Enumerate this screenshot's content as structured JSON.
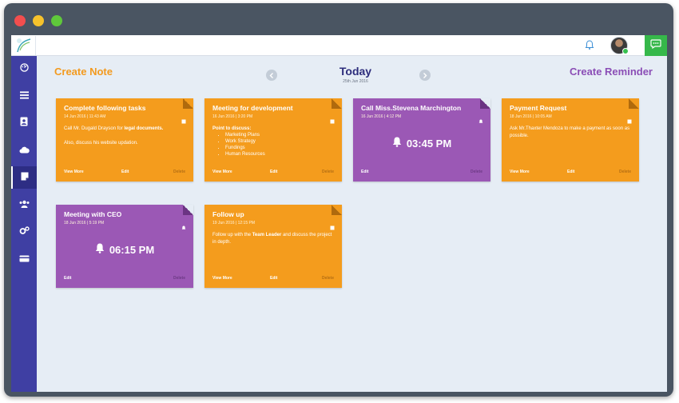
{
  "window": {
    "traffic_lights": [
      "close",
      "minimize",
      "maximize"
    ]
  },
  "topbar": {
    "icons": [
      "logo-icon",
      "bell-icon",
      "avatar",
      "chat-icon"
    ],
    "accent": "#36b84a"
  },
  "sidebar": {
    "color": "#3f3fa3",
    "items": [
      {
        "icon": "dashboard-icon"
      },
      {
        "icon": "list-icon"
      },
      {
        "icon": "contacts-icon"
      },
      {
        "icon": "cloud-icon"
      },
      {
        "icon": "notes-icon",
        "active": true
      },
      {
        "icon": "users-icon"
      },
      {
        "icon": "settings-icon"
      },
      {
        "icon": "card-icon"
      }
    ]
  },
  "header": {
    "create_note": "Create Note",
    "create_reminder": "Create Reminder",
    "today": "Today",
    "today_date": "25th Jun 2016"
  },
  "cards": [
    {
      "kind": "note",
      "color": "#f49c1d",
      "title": "Complete following tasks",
      "meta": "14 Jun 2016  |  11:43 AM",
      "line1_pre": "Call Mr. Dugald Drayson for ",
      "line1_bold": "legal documents.",
      "line2": "Also, discuss his website updation.",
      "view_more": "View More",
      "edit": "Edit",
      "delete": "Delete"
    },
    {
      "kind": "note",
      "color": "#f49c1d",
      "title": "Meeting for development",
      "meta": "16 Jun 2016  |  3:20 PM",
      "list_heading": "Point to discuss:",
      "list": [
        "Marketing Plans",
        "Work Strategy",
        "Fundings",
        "Human Resources"
      ],
      "view_more": "View More",
      "edit": "Edit",
      "delete": "Delete"
    },
    {
      "kind": "reminder",
      "color": "#9b58b5",
      "title": "Call Miss.Stevena Marchington",
      "meta": "16 Jun 2016  |  4:12 PM",
      "time": "03:45 PM",
      "edit": "Edit",
      "delete": "Delete"
    },
    {
      "kind": "note",
      "color": "#f49c1d",
      "title": "Payment Request",
      "meta": "18 Jun 2016  |  10:05 AM",
      "text": "Ask Mr.Thaxter Mendoza to make a payment as soon as possible.",
      "view_more": "View More",
      "edit": "Edit",
      "delete": "Delete"
    },
    {
      "kind": "reminder",
      "color": "#9b58b5",
      "title": "Meeting with CEO",
      "meta": "18 Jun 2016  |  5:19 PM",
      "time": "06:15 PM",
      "edit": "Edit",
      "delete": "Delete"
    },
    {
      "kind": "note",
      "color": "#f49c1d",
      "title": "Follow up",
      "meta": "19 Jun 2016  |  12:15 PM",
      "text_pre": "Follow up with the ",
      "text_bold": "Team Leader",
      "text_post": " and discuss the project in depth.",
      "view_more": "View More",
      "edit": "Edit",
      "delete": "Delete"
    }
  ]
}
